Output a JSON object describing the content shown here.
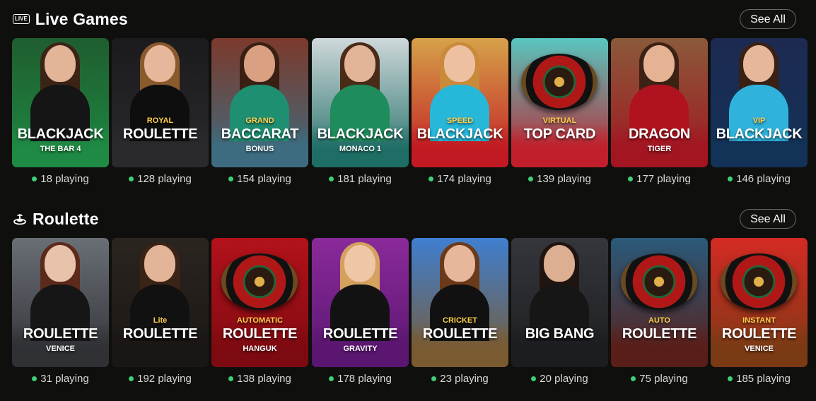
{
  "sections": [
    {
      "title": "Live Games",
      "badge": "LIVE",
      "see_all": "See All",
      "icon": "live-badge-icon",
      "games": [
        {
          "line1": "",
          "title": "BLACKJACK",
          "sub": "THE BAR 4",
          "players": "18 playing",
          "bg": "#1f5d2f",
          "table": "#1e8a43",
          "skin": "#e2b498",
          "hair": "#3b2416",
          "dress": "#151515"
        },
        {
          "line1": "ROYAL",
          "title": "ROULETTE",
          "sub": "",
          "players": "128 playing",
          "bg": "#1b1b1d",
          "table": "#2a2a2c",
          "skin": "#e6b79a",
          "hair": "#8a5a2d",
          "dress": "#0e0e0e"
        },
        {
          "line1": "GRAND",
          "title": "BACCARAT",
          "sub": "BONUS",
          "players": "154 playing",
          "bg": "#7c3a2c",
          "table": "#3d6c80",
          "skin": "#d9a082",
          "hair": "#3a1f12",
          "dress": "#1f8f72"
        },
        {
          "line1": "",
          "title": "BLACKJACK",
          "sub": "MONACO 1",
          "players": "181 playing",
          "bg": "#cfd8da",
          "table": "#1f6e66",
          "skin": "#e2b498",
          "hair": "#4a2b18",
          "dress": "#1e8c5b"
        },
        {
          "line1": "SPEED",
          "title": "BLACKJACK",
          "sub": "",
          "players": "174 playing",
          "bg": "#d6a24a",
          "table": "#c21a22",
          "skin": "#ecc0a0",
          "hair": "#c98a3a",
          "dress": "#27b7d9"
        },
        {
          "line1": "VIRTUAL",
          "title": "TOP CARD",
          "sub": "",
          "players": "139 playing",
          "bg": "#58c6bf",
          "table": "#c01f2b",
          "skin": "",
          "hair": "",
          "dress": ""
        },
        {
          "line1": "",
          "title": "DRAGON",
          "sub": "TIGER",
          "players": "177 playing",
          "bg": "#8a5a3a",
          "table": "#a21521",
          "skin": "#e5b393",
          "hair": "#3c2214",
          "dress": "#b0121f"
        },
        {
          "line1": "VIP",
          "title": "BLACKJACK",
          "sub": "",
          "players": "146 playing",
          "bg": "#1d2a52",
          "table": "#123257",
          "skin": "#e6b79a",
          "hair": "#3a2114",
          "dress": "#2fb3dc"
        }
      ]
    },
    {
      "title": "Roulette",
      "badge": "",
      "see_all": "See All",
      "icon": "roulette-wheel-icon",
      "games": [
        {
          "line1": "",
          "title": "ROULETTE",
          "sub": "VENICE",
          "players": "31 playing",
          "bg": "#6a6f76",
          "table": "#2f3135",
          "skin": "#e8c3ab",
          "hair": "#5c2a1a",
          "dress": "#161616"
        },
        {
          "line1": "Lite",
          "title": "ROULETTE",
          "sub": "",
          "players": "192 playing",
          "bg": "#2b2520",
          "table": "#1a1614",
          "skin": "#e2b498",
          "hair": "#3b2416",
          "dress": "#111111"
        },
        {
          "line1": "AUTOMATIC",
          "title": "ROULETTE",
          "sub": "HANGUK",
          "players": "138 playing",
          "bg": "#b3121b",
          "table": "#7d0a10",
          "skin": "",
          "hair": "",
          "dress": ""
        },
        {
          "line1": "",
          "title": "ROULETTE",
          "sub": "GRAVITY",
          "players": "178 playing",
          "bg": "#8a2a9a",
          "table": "#5a1670",
          "skin": "#efc6a6",
          "hair": "#d4a15e",
          "dress": "#121212"
        },
        {
          "line1": "CRICKET",
          "title": "ROULETTE",
          "sub": "",
          "players": "23 playing",
          "bg": "#3f7fd0",
          "table": "#7a5a30",
          "skin": "#e6b79a",
          "hair": "#6a3a1a",
          "dress": "#111111"
        },
        {
          "line1": "",
          "title": "BIG BANG",
          "sub": "",
          "players": "20 playing",
          "bg": "#34363b",
          "table": "#1c1d20",
          "skin": "#dcae92",
          "hair": "#1f1410",
          "dress": "#161616"
        },
        {
          "line1": "AUTO",
          "title": "ROULETTE",
          "sub": "",
          "players": "75 playing",
          "bg": "#2a5a7a",
          "table": "#5a1e18",
          "skin": "",
          "hair": "",
          "dress": ""
        },
        {
          "line1": "INSTANT",
          "title": "ROULETTE",
          "sub": "VENICE",
          "players": "185 playing",
          "bg": "#d42a24",
          "table": "#7a3a14",
          "skin": "",
          "hair": "",
          "dress": ""
        }
      ]
    }
  ]
}
